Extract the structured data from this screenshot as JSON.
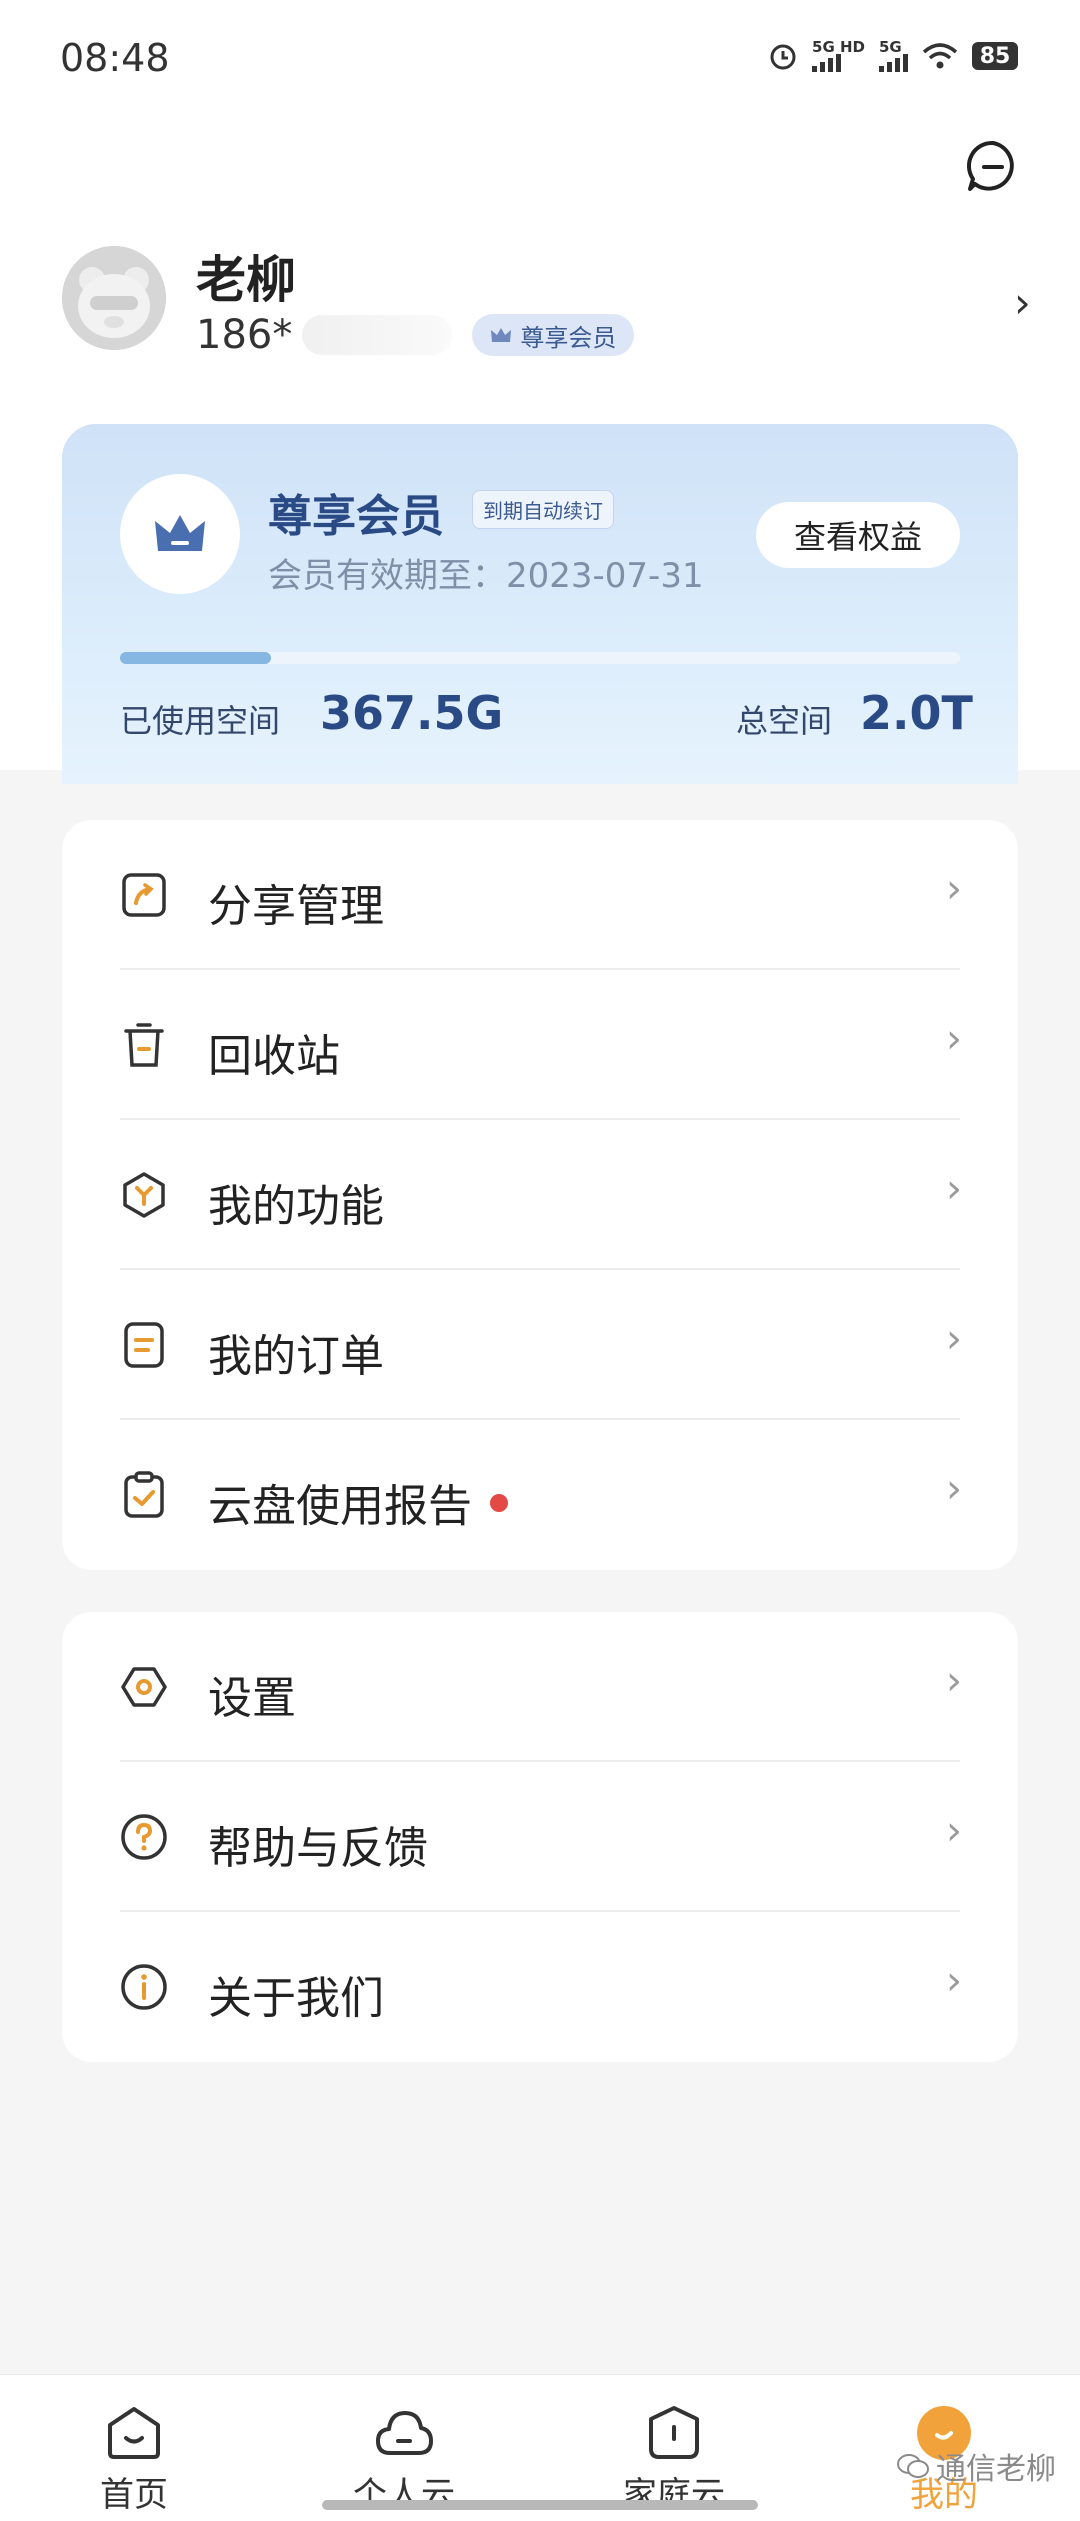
{
  "status_bar": {
    "time": "08:48",
    "battery": "85",
    "net1": "5G HD",
    "net2": "5G"
  },
  "profile": {
    "name": "老柳",
    "phone_prefix": "186*",
    "badge": "尊享会员"
  },
  "member_card": {
    "title": "尊享会员",
    "auto_renew_tag": "到期自动续订",
    "valid_until": "会员有效期至：2023-07-31",
    "view_button": "查看权益",
    "used_label": "已使用空间",
    "used_value": "367.5G",
    "total_label": "总空间",
    "total_value": "2.0T",
    "used_fraction": 0.18
  },
  "menu_group1": [
    {
      "label": "分享管理",
      "icon": "share-icon"
    },
    {
      "label": "回收站",
      "icon": "trash-icon"
    },
    {
      "label": "我的功能",
      "icon": "features-icon"
    },
    {
      "label": "我的订单",
      "icon": "order-icon"
    },
    {
      "label": "云盘使用报告",
      "icon": "report-icon",
      "dot": true
    }
  ],
  "menu_group2": [
    {
      "label": "设置",
      "icon": "settings-icon"
    },
    {
      "label": "帮助与反馈",
      "icon": "help-icon"
    },
    {
      "label": "关于我们",
      "icon": "info-icon"
    }
  ],
  "chevron": "›",
  "bottom_nav": [
    {
      "label": "首页",
      "icon": "home-icon"
    },
    {
      "label": "个人云",
      "icon": "cloud-icon"
    },
    {
      "label": "家庭云",
      "icon": "family-cloud-icon"
    },
    {
      "label": "我的",
      "icon": "me-icon",
      "active": true
    }
  ],
  "watermark": "通信老柳",
  "colors": {
    "accent": "#f1a23a",
    "member_blue": "#2a4a86",
    "dot_red": "#e34a45"
  }
}
